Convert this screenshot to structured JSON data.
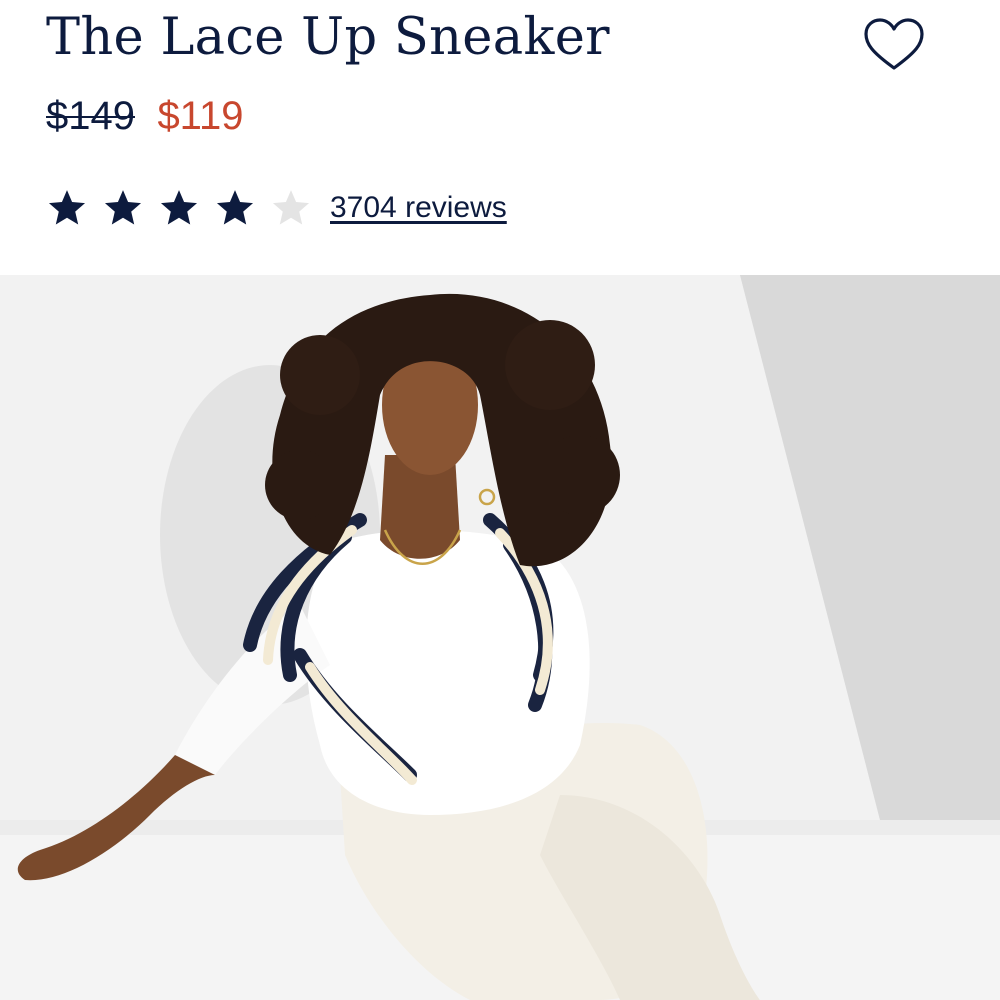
{
  "product": {
    "title": "The Lace Up Sneaker",
    "original_price": "$149",
    "sale_price": "$119",
    "rating": 4,
    "rating_max": 5,
    "reviews_label": "3704 reviews",
    "favorite_icon": "heart-outline-icon",
    "star_icon": "star-icon"
  },
  "colors": {
    "navy": "#0d1b3e",
    "sale_red": "#c8472e",
    "star_empty": "#e4e4e4",
    "background": "#ffffff"
  },
  "hero_image": {
    "description_icon": "model-photo"
  }
}
